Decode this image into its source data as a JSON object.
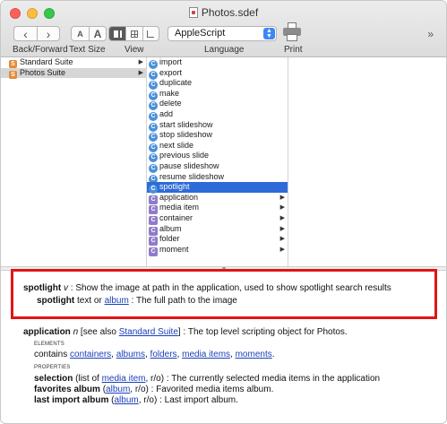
{
  "window": {
    "title": "Photos.sdef"
  },
  "toolbar": {
    "back_forward_label": "Back/Forward",
    "text_size_label": "Text Size",
    "view_label": "View",
    "language_label": "Language",
    "print_label": "Print",
    "language_value": "AppleScript",
    "text_size_small": "A",
    "text_size_large": "A",
    "back_glyph": "‹",
    "forward_glyph": "›",
    "more_glyph": "»"
  },
  "suites": [
    {
      "label": "Standard Suite",
      "icon": "S",
      "selected": false
    },
    {
      "label": "Photos Suite",
      "icon": "S",
      "selected": true
    }
  ],
  "terms": [
    {
      "label": "import",
      "kind": "command",
      "icon": "C"
    },
    {
      "label": "export",
      "kind": "command",
      "icon": "C"
    },
    {
      "label": "duplicate",
      "kind": "command",
      "icon": "C"
    },
    {
      "label": "make",
      "kind": "command",
      "icon": "C"
    },
    {
      "label": "delete",
      "kind": "command",
      "icon": "C"
    },
    {
      "label": "add",
      "kind": "command",
      "icon": "C"
    },
    {
      "label": "start slideshow",
      "kind": "command",
      "icon": "C"
    },
    {
      "label": "stop slideshow",
      "kind": "command",
      "icon": "C"
    },
    {
      "label": "next slide",
      "kind": "command",
      "icon": "C"
    },
    {
      "label": "previous slide",
      "kind": "command",
      "icon": "C"
    },
    {
      "label": "pause slideshow",
      "kind": "command",
      "icon": "C"
    },
    {
      "label": "resume slideshow",
      "kind": "command",
      "icon": "C"
    },
    {
      "label": "spotlight",
      "kind": "command",
      "icon": "C",
      "selected": true
    },
    {
      "label": "application",
      "kind": "class",
      "icon": "C",
      "chevron": true
    },
    {
      "label": "media item",
      "kind": "class",
      "icon": "C",
      "chevron": true
    },
    {
      "label": "container",
      "kind": "class",
      "icon": "C",
      "chevron": true
    },
    {
      "label": "album",
      "kind": "class",
      "icon": "C",
      "chevron": true
    },
    {
      "label": "folder",
      "kind": "class",
      "icon": "C",
      "chevron": true
    },
    {
      "label": "moment",
      "kind": "class",
      "icon": "C",
      "chevron": true
    }
  ],
  "doc": {
    "spotlight": {
      "name": "spotlight",
      "kind": "v",
      "desc": ": Show the image at path in the application, used to show spotlight search results",
      "param_name": "spotlight",
      "param_text": "text or",
      "param_link": "album",
      "param_desc": ": The full path to the image"
    },
    "application": {
      "name": "application",
      "kind": "n",
      "see_also_prefix": "[see also",
      "see_also_link": "Standard Suite",
      "see_also_suffix": "] : The top level scripting object for Photos.",
      "elements_heading": "ELEMENTS",
      "contains_prefix": "contains",
      "contains_links": [
        "containers",
        "albums",
        "folders",
        "media items",
        "moments"
      ],
      "properties_heading": "PROPERTIES",
      "prop1_name": "selection",
      "prop1_pre": "(list of",
      "prop1_link": "media item",
      "prop1_post": ", r/o) : The currently selected media items in the application",
      "prop2_name": "favorites album",
      "prop2_pre": "(",
      "prop2_link": "album",
      "prop2_post": ", r/o) : Favorited media items album.",
      "prop3_name": "last import album",
      "prop3_pre": "(",
      "prop3_link": "album",
      "prop3_post": ", r/o) : Last import album."
    }
  },
  "colors": {
    "selection": "#2f6bd8",
    "highlight_border": "#e01515",
    "link": "#1a3fb8"
  }
}
